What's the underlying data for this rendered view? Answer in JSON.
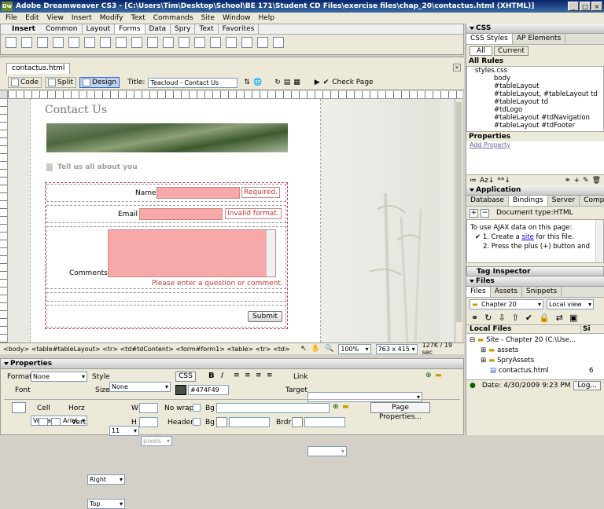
{
  "window": {
    "title": "Adobe Dreamweaver CS3 - [C:\\Users\\Tim\\Desktop\\School\\BE 171\\Student CD Files\\exercise files\\chap_20\\contactus.html (XHTML)]",
    "logo": "Dw"
  },
  "menu": [
    "File",
    "Edit",
    "View",
    "Insert",
    "Modify",
    "Text",
    "Commands",
    "Site",
    "Window",
    "Help"
  ],
  "insert_bar": {
    "title": "Insert",
    "tabs": [
      "Common",
      "Layout",
      "Forms",
      "Data",
      "Spry",
      "Text",
      "Favorites"
    ],
    "active_tab": "Forms"
  },
  "doc": {
    "tab": "contactus.html",
    "code_label": "Code",
    "split_label": "Split",
    "design_label": "Design",
    "title_label": "Title:",
    "title_value": "Teacloud - Contact Us",
    "check_page": "Check Page"
  },
  "page": {
    "heading": "Contact Us",
    "subheading": "Tell us all about you",
    "name_label": "Name",
    "name_error": "Required.",
    "email_label": "Email",
    "email_error": "Invalid format.",
    "comments_label": "Comments",
    "comments_error": "Please enter a question or comment.",
    "submit": "Submit"
  },
  "status": {
    "tags": "<body> <table#tableLayout> <tr> <td#tdContent> <form#form1> <table> <tr> <td>",
    "zoom": "100%",
    "size": "763 x 415",
    "download": "127K / 19 sec"
  },
  "properties": {
    "title": "Properties",
    "format_label": "Format",
    "format_value": "None",
    "style_label": "Style",
    "style_value": "None",
    "css_btn": "CSS",
    "link_label": "Link",
    "font_label": "Font",
    "font_value": "Verdana, Arial,",
    "size_label": "Size",
    "size_value": "11",
    "size_unit": "pixels",
    "color_value": "#474F49",
    "target_label": "Target",
    "cell_label": "Cell",
    "horz_label": "Horz",
    "horz_value": "Right",
    "w_label": "W",
    "nowrap_label": "No wrap",
    "bg_label": "Bg",
    "page_props": "Page Properties...",
    "vert_label": "Vert",
    "vert_value": "Top",
    "h_label": "H",
    "header_label": "Header",
    "bg2_label": "Bg",
    "brdr_label": "Brdr"
  },
  "css_panel": {
    "title": "CSS",
    "tabs": [
      "CSS Styles",
      "AP Elements"
    ],
    "all_btn": "All",
    "current_btn": "Current",
    "all_rules": "All Rules",
    "rules": [
      "styles.css",
      "body",
      "#tableLayout",
      "#tableLayout, #tableLayout td",
      "#tableLayout td",
      "#tdLogo",
      "#tableLayout #tdNavigation",
      "#tableLayout #tdFooter",
      "p"
    ],
    "properties": "Properties",
    "add_property": "Add Property"
  },
  "app_panel": {
    "title": "Application",
    "tabs": [
      "Database",
      "Bindings",
      "Server Beh",
      "Componen"
    ],
    "doc_type": "Document type:HTML",
    "intro": "To use AJAX data on this page:",
    "step1_pre": "1. Create a ",
    "step1_link": "site",
    "step1_post": " for this file.",
    "step2": "2. Press the plus (+) button and"
  },
  "tag_inspector": "Tag Inspector",
  "files_panel": {
    "title": "Files",
    "tabs": [
      "Files",
      "Assets",
      "Snippets"
    ],
    "site": "Chapter 20",
    "view": "Local view",
    "col_local": "Local Files",
    "col_size": "Si",
    "tree": [
      "Site - Chapter 20 (C:\\Use...",
      "assets",
      "SpryAssets",
      "contactus.html"
    ],
    "file_size": "6",
    "date": "Date: 4/30/2009 9:23 PM",
    "log": "Log..."
  }
}
